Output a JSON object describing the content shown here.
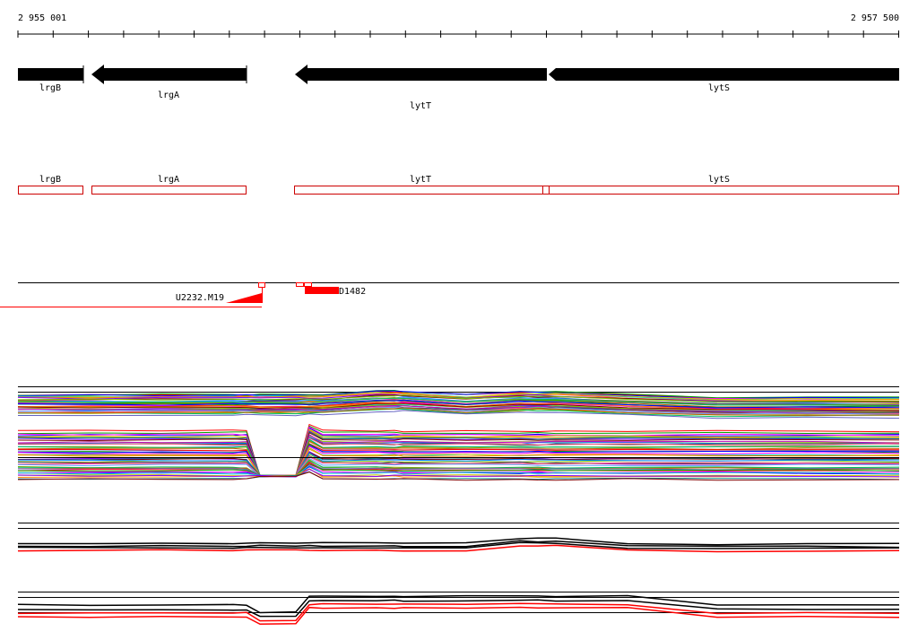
{
  "ruler": {
    "start_label": "2 955 001",
    "end_label": "2 957 500"
  },
  "genes": [
    {
      "name": "lrgB"
    },
    {
      "name": "lrgA"
    },
    {
      "name": "lytT"
    },
    {
      "name": "lytS"
    }
  ],
  "features": [
    {
      "name": "U2232.M19"
    },
    {
      "name": "D1482"
    }
  ],
  "colors": {
    "gene_arrow": "#000000",
    "gene_box": "#cc0000",
    "feature": "#ff0000",
    "track_line": "#000000"
  }
}
